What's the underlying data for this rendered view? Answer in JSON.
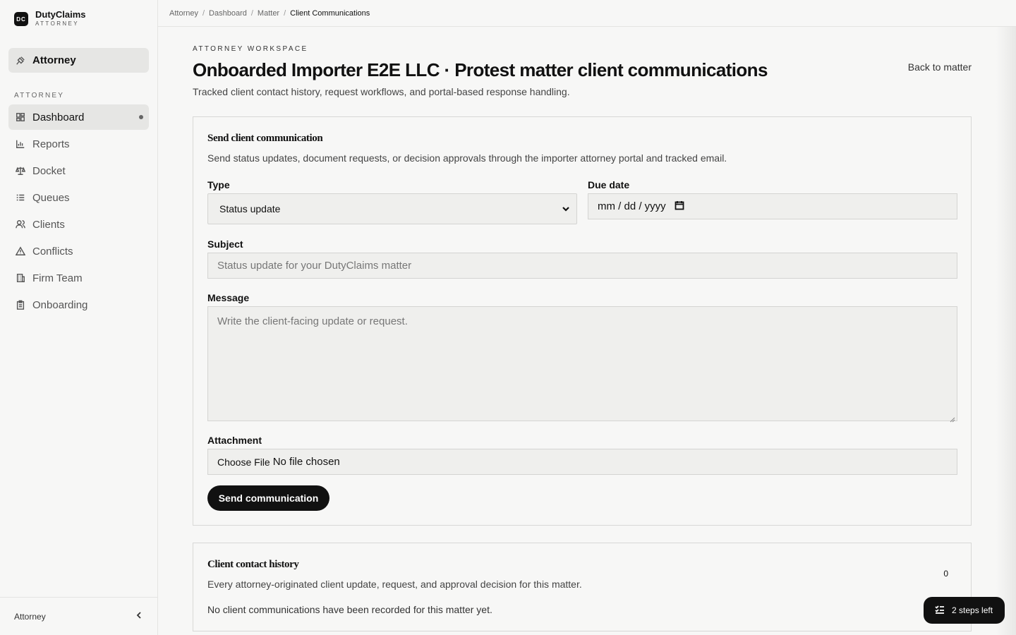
{
  "brand": {
    "logo_text": "DC",
    "name": "DutyClaims",
    "sub": "ATTORNEY"
  },
  "sidebar": {
    "role_label": "Attorney",
    "section_label": "ATTORNEY",
    "items": [
      {
        "label": "Dashboard",
        "icon": "dashboard-icon",
        "active": true
      },
      {
        "label": "Reports",
        "icon": "bar-chart-icon"
      },
      {
        "label": "Docket",
        "icon": "scale-icon"
      },
      {
        "label": "Queues",
        "icon": "list-checks-icon"
      },
      {
        "label": "Clients",
        "icon": "users-icon"
      },
      {
        "label": "Conflicts",
        "icon": "warning-icon"
      },
      {
        "label": "Firm Team",
        "icon": "building-icon"
      },
      {
        "label": "Onboarding",
        "icon": "clipboard-icon"
      }
    ],
    "footer_label": "Attorney"
  },
  "breadcrumb": [
    "Attorney",
    "Dashboard",
    "Matter",
    "Client Communications"
  ],
  "header": {
    "eyebrow": "ATTORNEY WORKSPACE",
    "title": "Onboarded Importer E2E LLC · Protest matter client communications",
    "subtitle": "Tracked client contact history, request workflows, and portal-based response handling.",
    "back_link": "Back to matter"
  },
  "send_form": {
    "title": "Send client communication",
    "description": "Send status updates, document requests, or decision approvals through the importer attorney portal and tracked email.",
    "type_label": "Type",
    "type_value": "Status update",
    "due_label": "Due date",
    "due_placeholder": "mm / dd / yyyy",
    "subject_label": "Subject",
    "subject_placeholder": "Status update for your DutyClaims matter",
    "message_label": "Message",
    "message_placeholder": "Write the client-facing update or request.",
    "attachment_label": "Attachment",
    "file_button": "Choose File",
    "file_status": "No file chosen",
    "submit_label": "Send communication"
  },
  "history": {
    "title": "Client contact history",
    "description": "Every attorney-originated client update, request, and approval decision for this matter.",
    "count": "0",
    "empty_text": "No client communications have been recorded for this matter yet."
  },
  "steps_pill": {
    "label": "2 steps left"
  }
}
